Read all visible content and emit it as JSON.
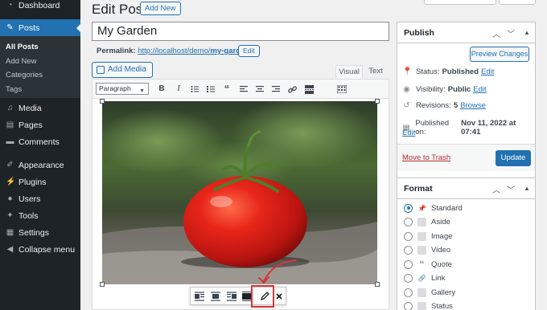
{
  "sidebar": {
    "dashboard": "Dashboard",
    "posts": "Posts",
    "sub": [
      "All Posts",
      "Add New",
      "Categories",
      "Tags"
    ],
    "media": "Media",
    "pages": "Pages",
    "comments": "Comments",
    "appearance": "Appearance",
    "plugins": "Plugins",
    "users": "Users",
    "tools": "Tools",
    "settings": "Settings",
    "collapse": "Collapse menu"
  },
  "header": {
    "title": "Edit Post",
    "add_new": "Add New"
  },
  "post": {
    "title_value": "My Garden",
    "permalink_label": "Permalink:",
    "permalink_base": "http://localhost/demo/",
    "permalink_slug": "my-garden",
    "permalink_end": "/",
    "permalink_edit": "Edit"
  },
  "editor": {
    "add_media": "Add Media",
    "tab_visual": "Visual",
    "tab_text": "Text",
    "format_value": "Paragraph"
  },
  "publish": {
    "title": "Publish",
    "preview": "Preview Changes",
    "status_label": "Status:",
    "status_value": "Published",
    "visibility_label": "Visibility:",
    "visibility_value": "Public",
    "revisions_label": "Revisions:",
    "revisions_value": "5",
    "browse": "Browse",
    "published_label": "Published on:",
    "published_value": "Nov 11, 2022 at 07:41",
    "edit": "Edit",
    "trash": "Move to Trash",
    "update": "Update"
  },
  "format": {
    "title": "Format",
    "options": [
      "Standard",
      "Aside",
      "Image",
      "Video",
      "Quote",
      "Link",
      "Gallery",
      "Status"
    ],
    "selected": "Standard"
  },
  "colors": {
    "accent": "#2271b1",
    "sidebar": "#1d2327",
    "highlight": "#d63638"
  }
}
